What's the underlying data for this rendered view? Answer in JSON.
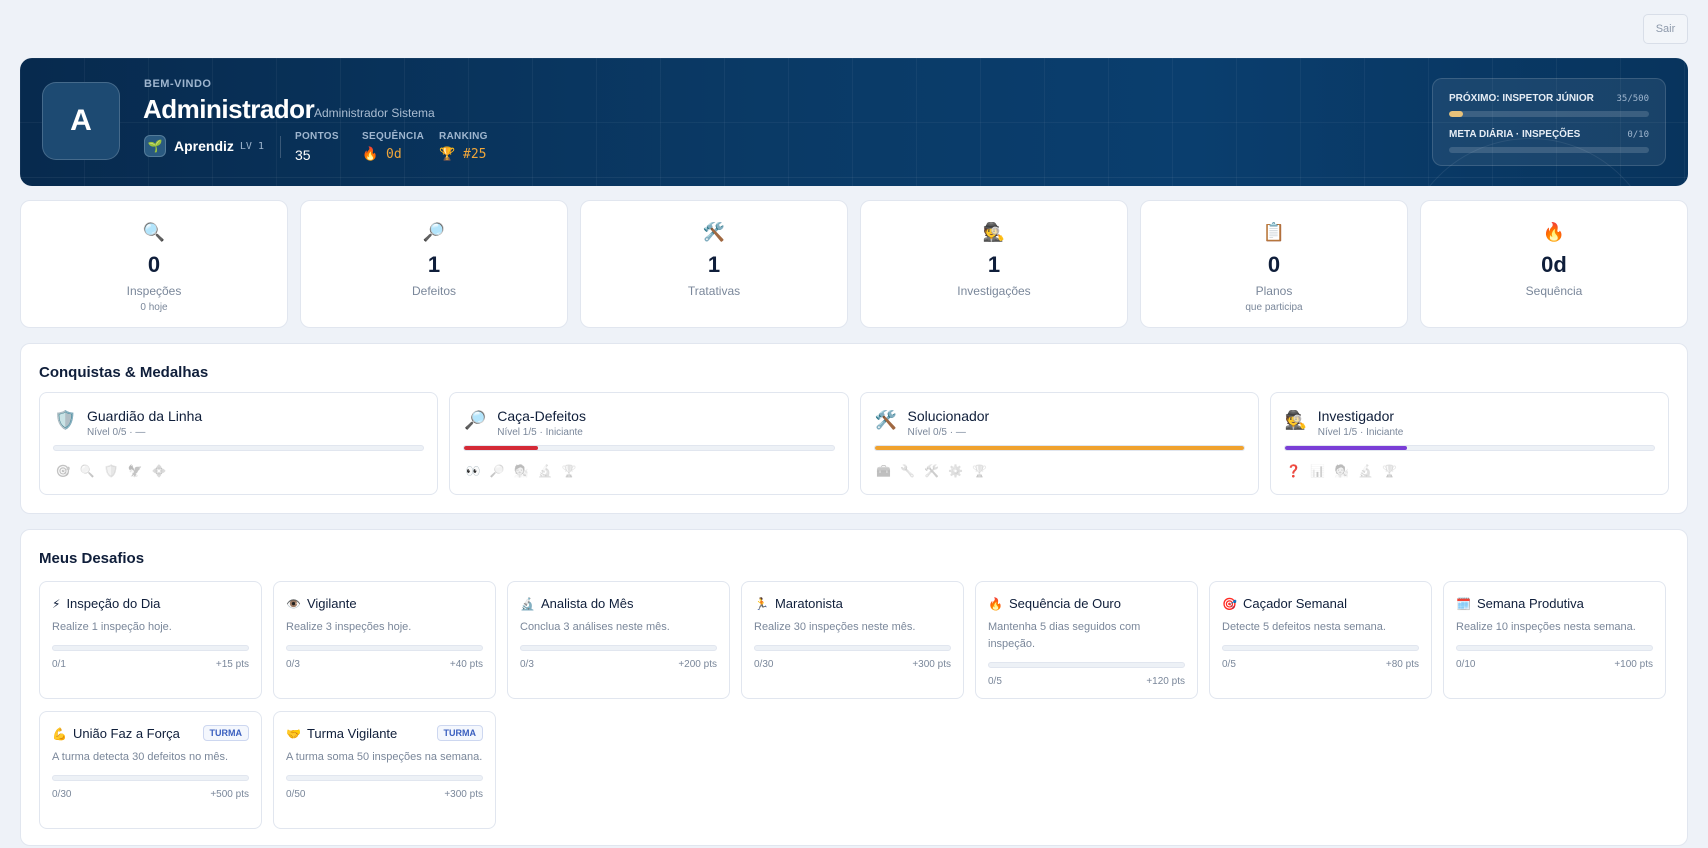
{
  "header": {
    "logout_label": "Sair"
  },
  "hero": {
    "avatar_initial": "A",
    "welcome": "BEM-VINDO",
    "name": "Administrador",
    "full_name": "Administrador Sistema",
    "level_icon": "seedling-icon",
    "level_name": "Aprendiz",
    "level_tag": "LV 1",
    "stats": [
      {
        "label": "PONTOS",
        "value": "35"
      },
      {
        "label": "SEQUÊNCIA",
        "value": "0d",
        "icon": "fire-icon"
      },
      {
        "label": "RANKING",
        "value": "#25",
        "icon": "trophy-icon"
      }
    ],
    "goals": [
      {
        "label": "PRÓXIMO: INSPETOR JÚNIOR",
        "count": "35/500",
        "progress": 0.07
      },
      {
        "label": "META DIÁRIA · INSPEÇÕES",
        "count": "0/10",
        "progress": 0
      }
    ]
  },
  "kpis": [
    {
      "icon": "🔍",
      "value": "0",
      "label": "Inspeções",
      "sub": "0 hoje"
    },
    {
      "icon": "🔎",
      "value": "1",
      "label": "Defeitos",
      "sub": ""
    },
    {
      "icon": "🛠️",
      "value": "1",
      "label": "Tratativas",
      "sub": ""
    },
    {
      "icon": "🕵️",
      "value": "1",
      "label": "Investigações",
      "sub": ""
    },
    {
      "icon": "📋",
      "value": "0",
      "label": "Planos",
      "sub": "que participa"
    },
    {
      "icon": "🔥",
      "value": "0d",
      "label": "Sequência",
      "sub": ""
    }
  ],
  "achievements": {
    "title": "Conquistas & Medalhas",
    "items": [
      {
        "icon": "🛡️",
        "name": "Guardião da Linha",
        "level": "Nível 0/5 · —",
        "progress": 0,
        "color": "#d0d7e2",
        "medals": [
          "🎯",
          "🔍",
          "🛡️",
          "🦅",
          "💠"
        ],
        "unlocked": 0
      },
      {
        "icon": "🔎",
        "name": "Caça-Defeitos",
        "level": "Nível 1/5 · Iniciante",
        "progress": 0.2,
        "color": "#d42a36",
        "medals": [
          "👀",
          "🔎",
          "🧑‍🔬",
          "🔬",
          "🏆"
        ],
        "unlocked": 1
      },
      {
        "icon": "🛠️",
        "name": "Solucionador",
        "level": "Nível 0/5 · —",
        "progress": 1.0,
        "color": "#f0a22e",
        "medals": [
          "🧰",
          "🔧",
          "🛠️",
          "⚙️",
          "🏆"
        ],
        "unlocked": 0
      },
      {
        "icon": "🕵️",
        "name": "Investigador",
        "level": "Nível 1/5 · Iniciante",
        "progress": 0.33,
        "color": "#7a3ed6",
        "medals": [
          "❓",
          "📊",
          "🧑‍🔬",
          "🔬",
          "🏆"
        ],
        "unlocked": 1
      }
    ]
  },
  "challenges": {
    "title": "Meus Desafios",
    "items": [
      {
        "icon": "⚡",
        "title": "Inspeção do Dia",
        "desc": "Realize 1 inspeção hoje.",
        "count": "0/1",
        "pts": "+15 pts",
        "badge": ""
      },
      {
        "icon": "👁️",
        "title": "Vigilante",
        "desc": "Realize 3 inspeções hoje.",
        "count": "0/3",
        "pts": "+40 pts",
        "badge": ""
      },
      {
        "icon": "🔬",
        "title": "Analista do Mês",
        "desc": "Conclua 3 análises neste mês.",
        "count": "0/3",
        "pts": "+200 pts",
        "badge": ""
      },
      {
        "icon": "🏃",
        "title": "Maratonista",
        "desc": "Realize 30 inspeções neste mês.",
        "count": "0/30",
        "pts": "+300 pts",
        "badge": ""
      },
      {
        "icon": "🔥",
        "title": "Sequência de Ouro",
        "desc": "Mantenha 5 dias seguidos com inspeção.",
        "count": "0/5",
        "pts": "+120 pts",
        "badge": ""
      },
      {
        "icon": "🎯",
        "title": "Caçador Semanal",
        "desc": "Detecte 5 defeitos nesta semana.",
        "count": "0/5",
        "pts": "+80 pts",
        "badge": ""
      },
      {
        "icon": "🗓️",
        "title": "Semana Produtiva",
        "desc": "Realize 10 inspeções nesta semana.",
        "count": "0/10",
        "pts": "+100 pts",
        "badge": ""
      },
      {
        "icon": "💪",
        "title": "União Faz a Força",
        "desc": "A turma detecta 30 defeitos no mês.",
        "count": "0/30",
        "pts": "+500 pts",
        "badge": "TURMA"
      },
      {
        "icon": "🤝",
        "title": "Turma Vigilante",
        "desc": "A turma soma 50 inspeções na semana.",
        "count": "0/50",
        "pts": "+300 pts",
        "badge": "TURMA"
      }
    ]
  }
}
